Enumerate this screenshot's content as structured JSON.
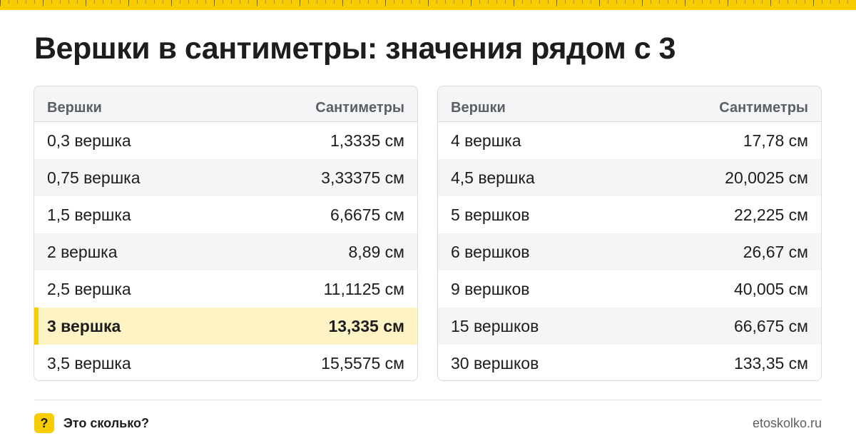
{
  "title": "Вершки в сантиметры: значения рядом с 3",
  "colors": {
    "accent": "#f7cd00",
    "highlight_bg": "#fdf3c4",
    "row_alt_bg": "#f4f5f6"
  },
  "tables": [
    {
      "headers": [
        "Вершки",
        "Сантиметры"
      ],
      "rows": [
        [
          "0,3 вершка",
          "1,3335 см"
        ],
        [
          "0,75 вершка",
          "3,33375 см"
        ],
        [
          "1,5 вершка",
          "6,6675 см"
        ],
        [
          "2 вершка",
          "8,89 см"
        ],
        [
          "2,5 вершка",
          "11,1125 см"
        ],
        [
          "3 вершка",
          "13,335 см"
        ],
        [
          "3,5 вершка",
          "15,5575 см"
        ]
      ],
      "highlight_row": 5
    },
    {
      "headers": [
        "Вершки",
        "Сантиметры"
      ],
      "rows": [
        [
          "4 вершка",
          "17,78 см"
        ],
        [
          "4,5 вершка",
          "20,0025 см"
        ],
        [
          "5 вершков",
          "22,225 см"
        ],
        [
          "6 вершков",
          "26,67 см"
        ],
        [
          "9 вершков",
          "40,005 см"
        ],
        [
          "15 вершков",
          "66,675 см"
        ],
        [
          "30 вершков",
          "133,35 см"
        ]
      ]
    }
  ],
  "footer": {
    "logo_icon": "question-mark-icon",
    "logo_glyph": "?",
    "brand": "Это сколько?",
    "site": "etoskolko.ru"
  }
}
